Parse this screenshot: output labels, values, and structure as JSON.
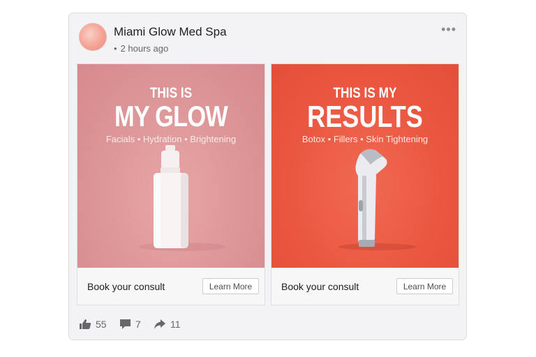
{
  "post": {
    "page_name": "Miami Glow Med Spa",
    "time": "2 hours ago",
    "separator": "•"
  },
  "cards": [
    {
      "headline_small": "THIS IS",
      "headline_big": "MY GLOW",
      "tagline": "Facials • Hydration • Brightening",
      "background": "#dc9496",
      "cta_text": "Book your consult",
      "cta_button": "Learn More"
    },
    {
      "headline_small": "THIS IS MY",
      "headline_big": "RESULTS",
      "tagline": "Botox • Fillers • Skin Tightening",
      "background": "#ea5640",
      "cta_text": "Book your consult",
      "cta_button": "Learn More"
    }
  ],
  "reactions": {
    "likes": "55",
    "comments": "7",
    "shares": "11"
  },
  "icons": [
    "more-options-icon",
    "like-icon",
    "comment-icon",
    "share-icon"
  ],
  "colors": {
    "card_bg": "#f3f3f5",
    "text_secondary": "#65676b"
  }
}
